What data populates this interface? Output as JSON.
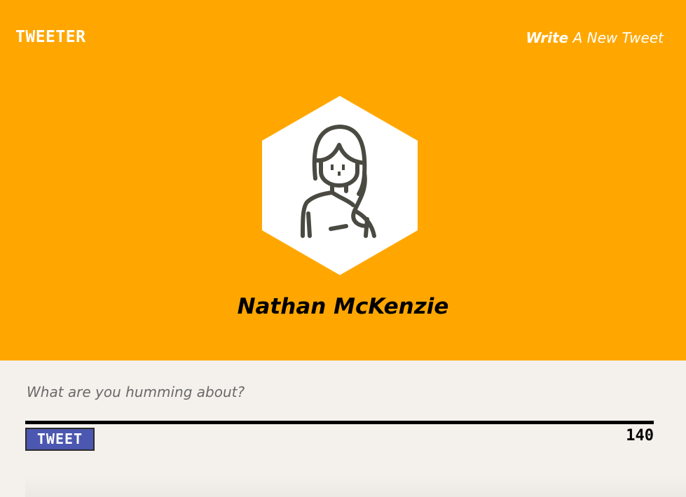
{
  "header": {
    "logo_text": "TWEETER",
    "write_link": {
      "strong": "Write",
      "rest": " A New Tweet"
    },
    "background_color": "#ffa700"
  },
  "profile": {
    "avatar_icon": "user-avatar-icon",
    "name": "Nathan McKenzie"
  },
  "compose": {
    "placeholder": "What are you humming about?",
    "value": "",
    "button_label": "TWEET",
    "button_color": "#4b57b0",
    "char_count": "140"
  }
}
